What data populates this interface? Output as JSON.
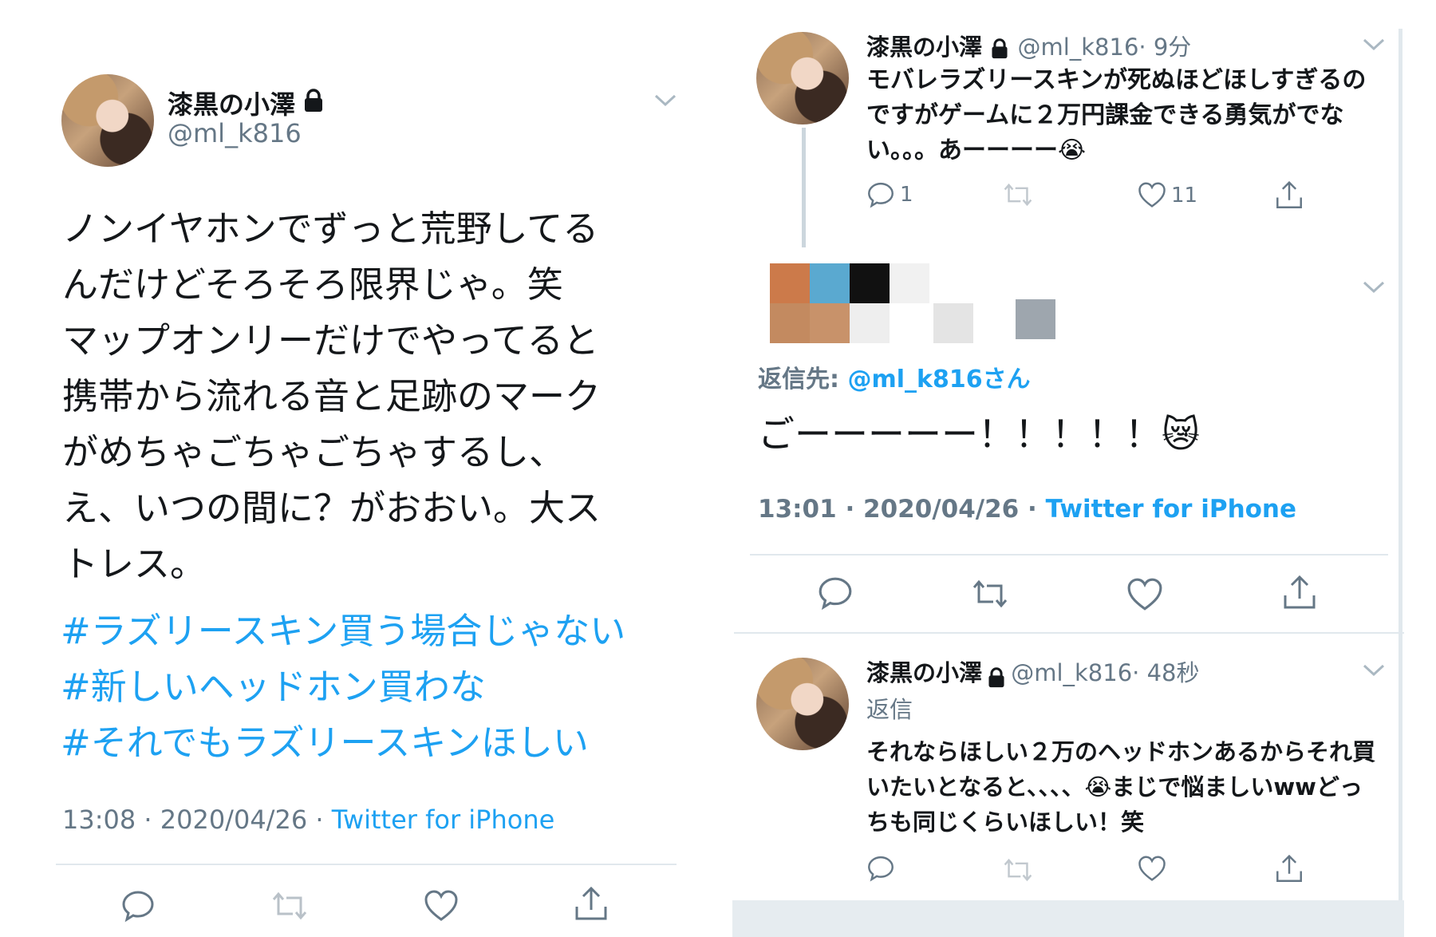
{
  "left_tweet": {
    "name": "漆黒の小澤",
    "handle": "@ml_k816",
    "body_lines": [
      "ノンイヤホンでずっと荒野してる",
      "んだけどそろそろ限界じゃ。笑",
      "マップオンリーだけでやってると",
      "携帯から流れる音と足跡のマーク",
      "がめちゃごちゃごちゃするし、",
      "え、いつの間に？がおおい。大ス",
      "トレス。"
    ],
    "hashtags": [
      "#ラズリースキン買う場合じゃない",
      "#新しいヘッドホン買わな",
      "#それでもラズリースキンほしい"
    ],
    "time": "13:08 · 2020/04/26 · ",
    "source": "Twitter for iPhone"
  },
  "right_top_tweet": {
    "name": "漆黒の小澤",
    "handle": "@ml_k816",
    "age": "· 9分",
    "body": "モバレラズリースキンが死ぬほどほしすぎるのですがゲームに２万円課金できる勇気がでない。。。あーーーー😭",
    "reply_count": "1",
    "like_count": "11"
  },
  "right_focus_tweet": {
    "reply_prefix": "返信先: ",
    "reply_to": "@ml_k816さん",
    "body": "ごーーーーー！！！！！😿",
    "time": "13:01 · 2020/04/26 · ",
    "source": "Twitter for iPhone"
  },
  "right_bottom_tweet": {
    "name": "漆黒の小澤",
    "handle": "@ml_k816",
    "age": "· 48秒",
    "reply_prefix": "返信",
    "body": "それならほしい２万のヘッドホンあるからそれ買いたいとなると、、、、😭まじで悩ましいwwどっちも同じくらいほしい！笑"
  },
  "colors": {
    "accent": "#1da1f2",
    "muted": "#657786",
    "separator": "#e1e8ed"
  }
}
